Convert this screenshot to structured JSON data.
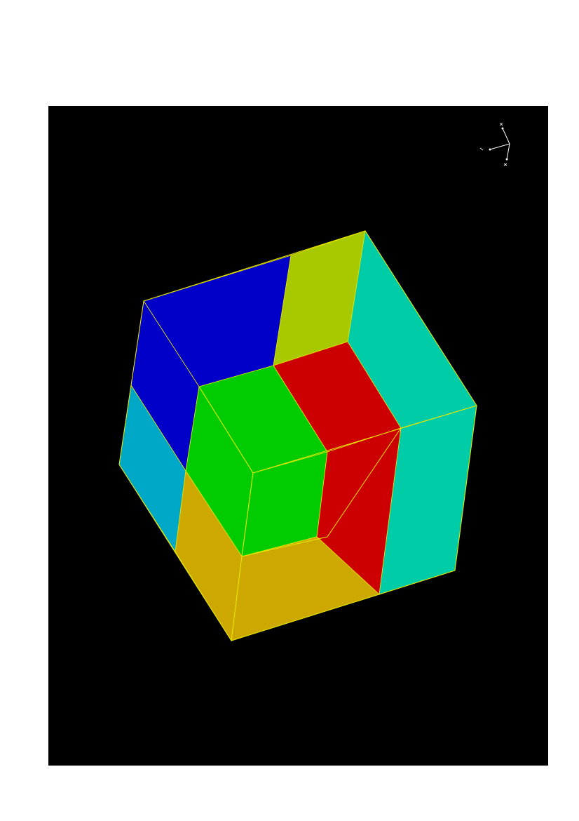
{
  "scene": {
    "background": "#000000",
    "page_background": "#ffffff",
    "edge_color": "#e8e800",
    "triad_color": "#ffffff",
    "region_colors": {
      "blue": "#0000c8",
      "olive": "#a8c800",
      "teal": "#00cca8",
      "sky": "#00a8c8",
      "green": "#00cc00",
      "red": "#cc0000",
      "gold": "#cca800"
    }
  }
}
